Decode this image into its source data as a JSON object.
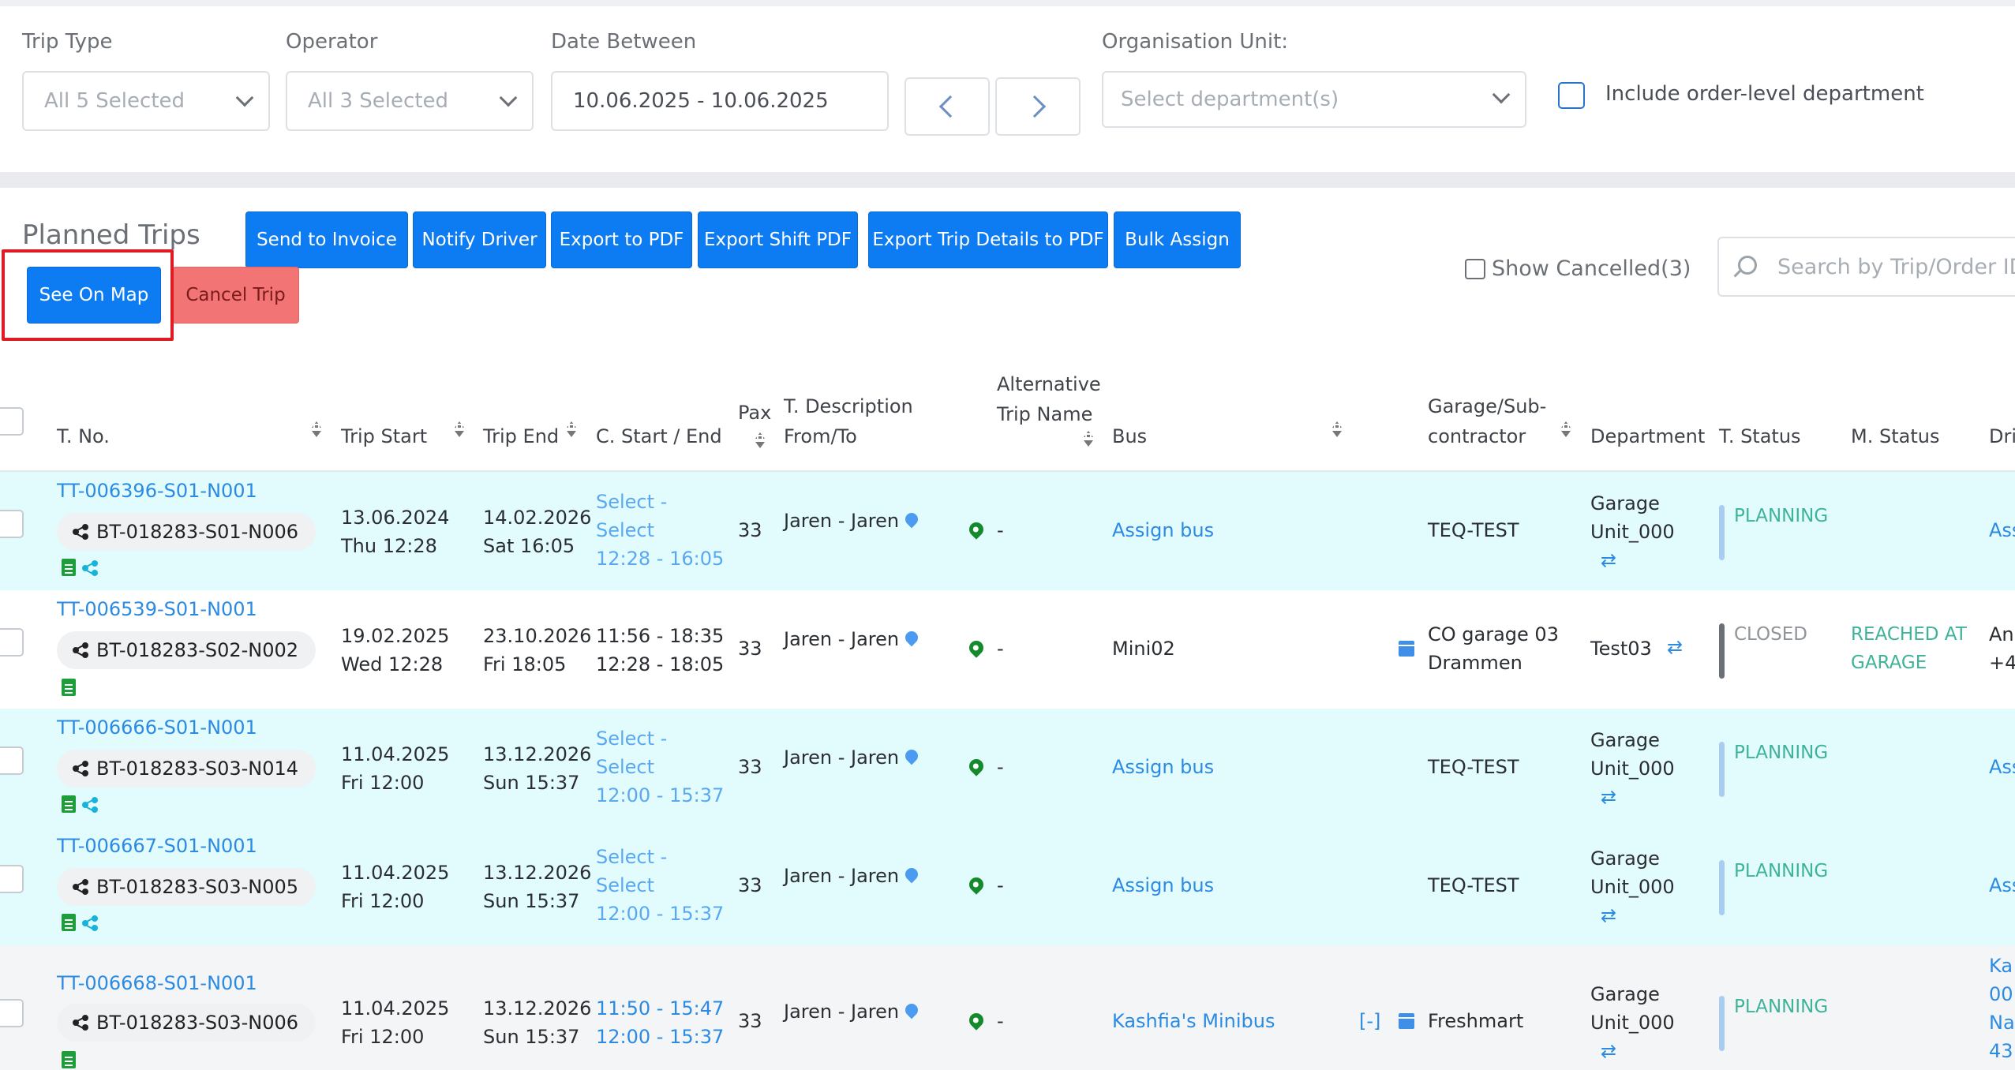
{
  "filters": {
    "trip_type": {
      "label": "Trip Type",
      "value": "All 5 Selected"
    },
    "operator": {
      "label": "Operator",
      "value": "All 3 Selected"
    },
    "date_between": {
      "label": "Date Between",
      "value": "10.06.2025 - 10.06.2025"
    },
    "org_unit": {
      "label": "Organisation Unit:",
      "placeholder": "Select department(s)"
    },
    "include_order_level": "Include order-level department"
  },
  "toolbar": {
    "title": "Planned Trips",
    "send_to_invoice": "Send to Invoice",
    "notify_driver": "Notify Driver",
    "export_pdf": "Export to PDF",
    "export_shift_pdf": "Export Shift PDF",
    "export_trip_details_pdf": "Export Trip Details to PDF",
    "bulk_assign": "Bulk Assign",
    "see_on_map": "See On Map",
    "cancel_trip": "Cancel Trip",
    "show_cancelled": "Show Cancelled(3)",
    "search_placeholder": "Search by Trip/Order ID"
  },
  "columns": {
    "tno": "T. No.",
    "trip_start": "Trip Start",
    "trip_end": "Trip End",
    "c_start_end": "C. Start / End",
    "pax": "Pax",
    "desc_1": "T. Description",
    "desc_2": "From/To",
    "alt_1": "Alternative",
    "alt_2": "Trip Name",
    "bus": "Bus",
    "garage_1": "Garage/Sub-",
    "garage_2": "contractor",
    "department": "Department",
    "t_status": "T. Status",
    "m_status": "M. Status",
    "driver": "Dri"
  },
  "rows": [
    {
      "tno": "TT-006396-S01-N001",
      "bt": "BT-018283-S01-N006",
      "start_date": "13.06.2024",
      "start_time": "Thu 12:28",
      "end_date": "14.02.2026",
      "end_time": "Sat 16:05",
      "c1": "Select -",
      "c2": "Select",
      "c3": "12:28 - 16:05",
      "pax": "33",
      "desc": "Jaren - Jaren",
      "alt": "-",
      "bus": "Assign bus",
      "garage_1": "TEQ-TEST",
      "garage_2": "",
      "dept_1": "Garage",
      "dept_2": "Unit_000",
      "t_status": "PLANNING",
      "m_status_1": "",
      "m_status_2": "",
      "driver_1": "Ass",
      "driver_2": "",
      "driver_3": "",
      "driver_4": ""
    },
    {
      "tno": "TT-006539-S01-N001",
      "bt": "BT-018283-S02-N002",
      "start_date": "19.02.2025",
      "start_time": "Wed 12:28",
      "end_date": "23.10.2026",
      "end_time": "Fri 18:05",
      "c1": "11:56 - 18:35",
      "c2": "12:28 - 18:05",
      "c3": "",
      "pax": "33",
      "desc": "Jaren - Jaren",
      "alt": "-",
      "bus": "Mini02",
      "garage_1": "CO garage 03",
      "garage_2": "Drammen",
      "dept_1": "Test03",
      "dept_2": "",
      "t_status": "CLOSED",
      "m_status_1": "REACHED AT",
      "m_status_2": "GARAGE",
      "driver_1": "An",
      "driver_2": "+4",
      "driver_3": "",
      "driver_4": ""
    },
    {
      "tno": "TT-006666-S01-N001",
      "bt": "BT-018283-S03-N014",
      "start_date": "11.04.2025",
      "start_time": "Fri 12:00",
      "end_date": "13.12.2026",
      "end_time": "Sun 15:37",
      "c1": "Select -",
      "c2": "Select",
      "c3": "12:00 - 15:37",
      "pax": "33",
      "desc": "Jaren - Jaren",
      "alt": "-",
      "bus": "Assign bus",
      "garage_1": "TEQ-TEST",
      "garage_2": "",
      "dept_1": "Garage",
      "dept_2": "Unit_000",
      "t_status": "PLANNING",
      "m_status_1": "",
      "m_status_2": "",
      "driver_1": "Ass",
      "driver_2": "",
      "driver_3": "",
      "driver_4": ""
    },
    {
      "tno": "TT-006667-S01-N001",
      "bt": "BT-018283-S03-N005",
      "start_date": "11.04.2025",
      "start_time": "Fri 12:00",
      "end_date": "13.12.2026",
      "end_time": "Sun 15:37",
      "c1": "Select -",
      "c2": "Select",
      "c3": "12:00 - 15:37",
      "pax": "33",
      "desc": "Jaren - Jaren",
      "alt": "-",
      "bus": "Assign bus",
      "garage_1": "TEQ-TEST",
      "garage_2": "",
      "dept_1": "Garage",
      "dept_2": "Unit_000",
      "t_status": "PLANNING",
      "m_status_1": "",
      "m_status_2": "",
      "driver_1": "Ass",
      "driver_2": "",
      "driver_3": "",
      "driver_4": ""
    },
    {
      "tno": "TT-006668-S01-N001",
      "bt": "BT-018283-S03-N006",
      "start_date": "11.04.2025",
      "start_time": "Fri 12:00",
      "end_date": "13.12.2026",
      "end_time": "Sun 15:37",
      "c1": "11:50 - 15:47",
      "c2": "12:00 - 15:37",
      "c3": "",
      "pax": "33",
      "desc": "Jaren - Jaren",
      "alt": "-",
      "bus": "Kashfia's Minibus",
      "bus_tag": "[-]",
      "garage_1": "Freshmart",
      "garage_2": "",
      "dept_1": "Garage",
      "dept_2": "Unit_000",
      "t_status": "PLANNING",
      "m_status_1": "",
      "m_status_2": "",
      "driver_1": "Ka",
      "driver_2": "00",
      "driver_3": "Na",
      "driver_4": "43"
    }
  ],
  "colors": {
    "primary": "#0d7cf2",
    "danger": "#f27474",
    "planning": "#3fb39a",
    "closed": "#8f9499",
    "link": "#2b8be3"
  },
  "icons": [
    "chevron-down-icon",
    "chevron-left-icon",
    "chevron-right-icon",
    "search-icon",
    "share-icon",
    "document-icon",
    "map-pin-icon",
    "calendar-icon",
    "swap-icon",
    "sort-icon"
  ]
}
